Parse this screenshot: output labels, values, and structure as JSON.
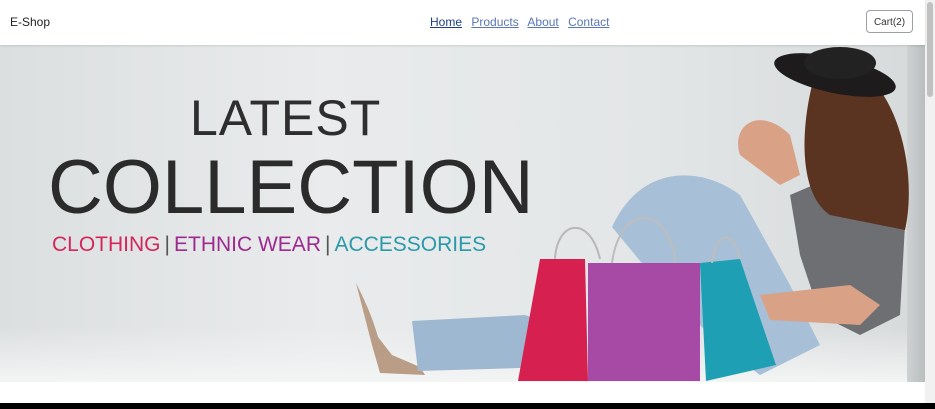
{
  "navbar": {
    "brand": "E-Shop",
    "links": [
      "Home",
      "Products",
      "About",
      "Contact"
    ],
    "cart_label": "Cart(2)"
  },
  "hero": {
    "headline_top": "LATEST",
    "headline_main": "COLLECTION",
    "categories": [
      "CLOTHING",
      "ETHNIC WEAR",
      "ACCESSORIES"
    ],
    "separator": "|"
  }
}
